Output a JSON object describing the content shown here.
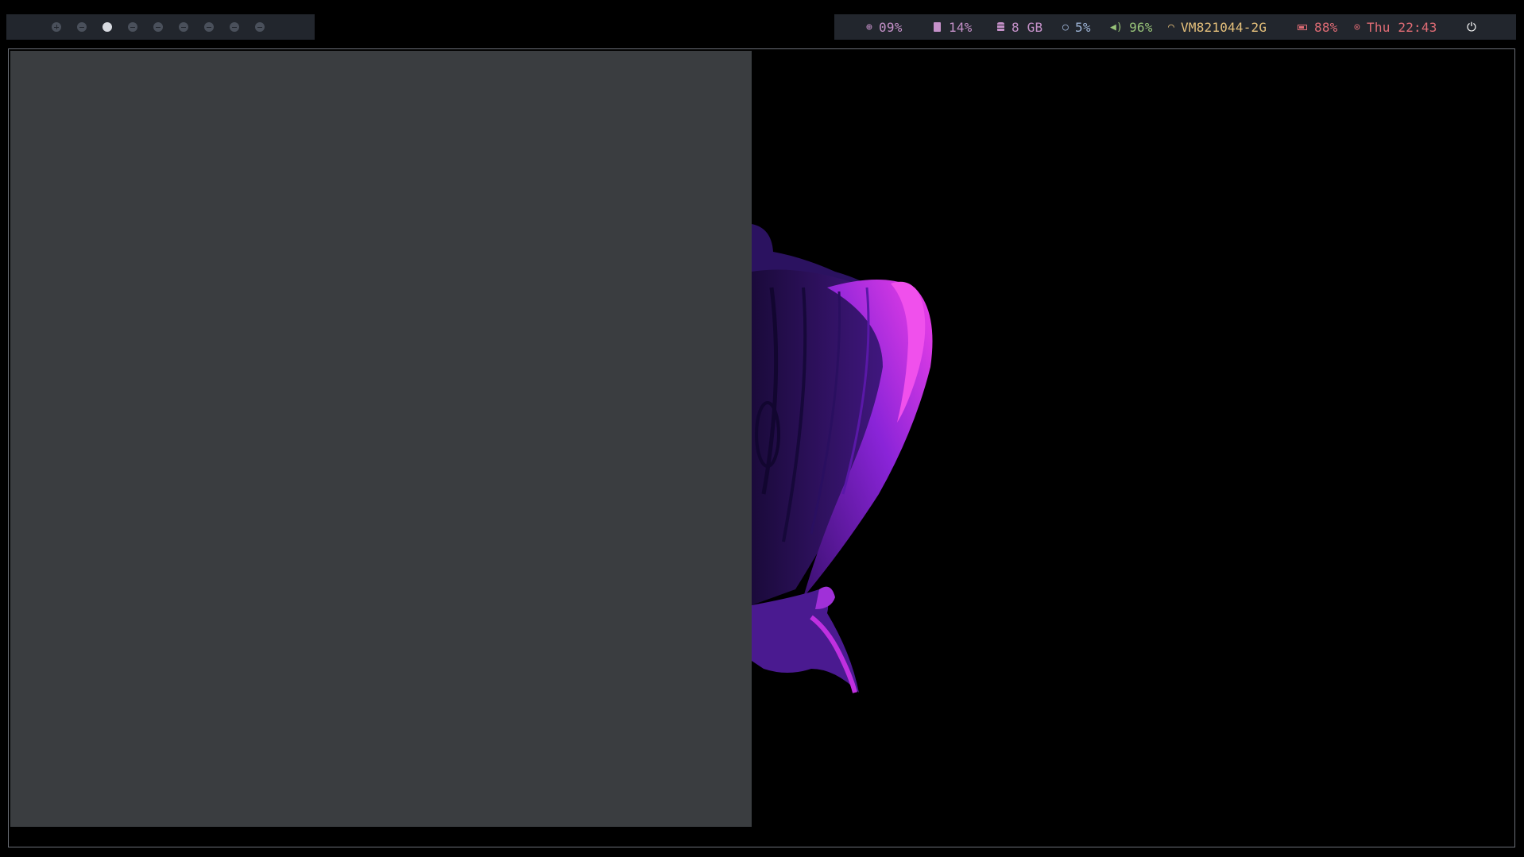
{
  "workspaces": {
    "count": 9,
    "active_index": 3
  },
  "status": {
    "cpu": "09%",
    "disk": "14%",
    "memory": "8 GB",
    "brightness": "5%",
    "volume": "96%",
    "wifi_ssid": "VM821044-2G",
    "battery": "88%",
    "clock": "Thu 22:43"
  },
  "colors": {
    "bar_bg": "#22262d",
    "cpu": "#c591c9",
    "disk": "#c591c9",
    "memory": "#c591c9",
    "brightness": "#9eb4d6",
    "volume": "#98c379",
    "wifi": "#e5c07b",
    "battery": "#e06c75",
    "clock": "#e06c75",
    "power": "#ffffff",
    "window_bg": "#3a3d40",
    "wallpaper_bg": "#000000"
  },
  "icons": {
    "cpu": "cpu-icon",
    "disk": "disk-icon",
    "memory": "memory-icon",
    "brightness": "brightness-icon",
    "volume": "volume-icon",
    "wifi": "wifi-icon",
    "battery": "battery-icon",
    "clock": "clock-icon",
    "power": "power-icon"
  }
}
